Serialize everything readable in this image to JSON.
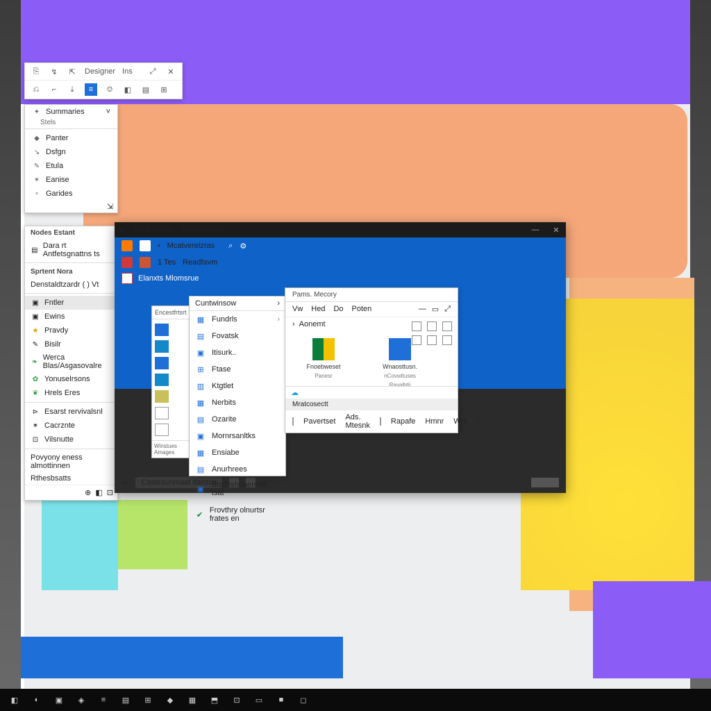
{
  "toolbox": {
    "tab1": "Designer",
    "tab2": "Ins"
  },
  "sidepanel": {
    "header": "Summaries",
    "chev": "˅",
    "items": [
      "Stels",
      "Panter",
      "Dsfgn",
      "Etula",
      "Eanise",
      "Garides"
    ]
  },
  "ctxpanel": {
    "header1": "Nodes Estant",
    "item1": "Dara rt Antfetsgnattns ts",
    "header2": "Sprtent Nora",
    "item2": "Denstaldtzardr ( ) Vt",
    "secA": "Fntler",
    "items": [
      "Ewins",
      "Pravdy",
      "Bisilr",
      "Werca Blas/Asgasovalre",
      "Yonuselrsons",
      "Hrels Eres",
      "Esarst rervivalsnl",
      "Cacrznte",
      "Vilsnutte"
    ],
    "footer1": "Povyony eness almottinnen",
    "footer2": "Rthesbsatts"
  },
  "appwin": {
    "title_back": "⟲",
    "title1": "Hnartntfem",
    "title2": "Hmadetrixts",
    "tab_app": "Mcatverelzras",
    "rib_lbl": "1 Tes",
    "rib2": "Readfavm",
    "sub_lbl": "Elanxts Mlomsrue",
    "status_text": "Castssunrnaat dassos"
  },
  "panelA": {
    "header": "Encestfrtsrt",
    "footer": "Winstues Amages"
  },
  "panelB": {
    "header": "Cuntwinsow",
    "items": [
      "Fundrls",
      "Fovatsk",
      "Itisurk..",
      "Ftase",
      "Ktgtlet",
      "Nerbits",
      "Ozarite",
      "Mornrsanltks",
      "Ensiabe",
      "Anurhrees",
      "Bistfrishoaernsn tsat"
    ],
    "footer": "Frovthry olnurtsr frates en"
  },
  "panelC": {
    "title": "Pams. Mecory",
    "menus": [
      "Vw",
      "Hed",
      "Do",
      "Poten"
    ],
    "crumb": "Aonemt",
    "file1": "Fnoebweset",
    "file1b": "Panesr",
    "file2": "Wnaosttusn.",
    "file2b": "nCovwttuses",
    "file2c": "Ravalbtii",
    "tab": "Mratcosectt",
    "tools": [
      "Pavertset",
      "Ads. Mtesnk",
      "Rapafe",
      "Hmnr",
      "Wht"
    ]
  },
  "taskbar": {
    "icons": [
      "◧",
      "◐",
      "▣",
      "◈",
      "≡",
      "▤",
      "⊞",
      "◆",
      "▦",
      "⬒",
      "⊡",
      "▭",
      "■",
      "◻"
    ]
  }
}
